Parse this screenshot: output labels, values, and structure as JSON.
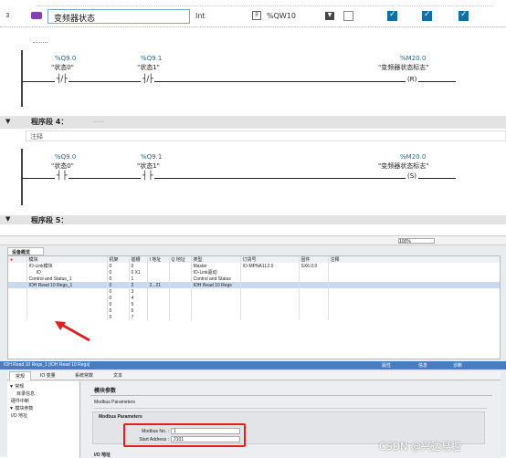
{
  "tag_row": {
    "row_number": "3",
    "name": "变频器状态",
    "type": "Int",
    "address": "%QW10"
  },
  "network3": {
    "contact1": {
      "address": "%Q9.0",
      "label": "\"状态0\""
    },
    "contact2": {
      "address": "%Q9.1",
      "label": "\"状态1\""
    },
    "coil": {
      "address": "%M20.0",
      "label": "\"变频器状态标志\"",
      "symbol": "R"
    }
  },
  "network4": {
    "header": "程序段 4：",
    "header_dots": "......",
    "comment": "注释",
    "contact1": {
      "address": "%Q9.0",
      "label": "\"状态0\""
    },
    "contact2": {
      "address": "%Q9.1",
      "label": "\"状态1\""
    },
    "coil": {
      "address": "%M20.0",
      "label": "\"变频器状态标志\"",
      "symbol": "S"
    }
  },
  "network5": {
    "header": "程序段 5："
  },
  "device_overview": {
    "zoom": "100%",
    "tab": "设备概览",
    "columns": [
      "模块",
      "机架",
      "插槽",
      "I 地址",
      "Q 地址",
      "类型",
      "订货号",
      "固件",
      "注释"
    ],
    "rows": [
      {
        "module": "IO-Link模块",
        "rack": "0",
        "slot": "0",
        "i_addr": "",
        "q_addr": "",
        "type": "Master",
        "order": "IO-MPNA1L2.0",
        "fw": "SX6.0.0"
      },
      {
        "module": "IO",
        "rack": "0",
        "slot": "0 X1",
        "i_addr": "",
        "q_addr": "",
        "type": "IO-Link驱动",
        "order": "",
        "fw": ""
      },
      {
        "module": "Control and Status_1",
        "rack": "0",
        "slot": "1",
        "i_addr": "",
        "q_addr": "",
        "type": "Control and Status",
        "order": "",
        "fw": ""
      },
      {
        "module": "IOH Read 10 Regs_1",
        "rack": "0",
        "slot": "2",
        "i_addr": "2...21",
        "q_addr": "",
        "type": "IOH Read 10 Regs",
        "order": "",
        "fw": ""
      },
      {
        "module": "",
        "rack": "0",
        "slot": "3",
        "i_addr": "",
        "q_addr": "",
        "type": "",
        "order": "",
        "fw": ""
      },
      {
        "module": "",
        "rack": "0",
        "slot": "4",
        "i_addr": "",
        "q_addr": "",
        "type": "",
        "order": "",
        "fw": ""
      },
      {
        "module": "",
        "rack": "0",
        "slot": "5",
        "i_addr": "",
        "q_addr": "",
        "type": "",
        "order": "",
        "fw": ""
      },
      {
        "module": "",
        "rack": "0",
        "slot": "6",
        "i_addr": "",
        "q_addr": "",
        "type": "",
        "order": "",
        "fw": ""
      },
      {
        "module": "",
        "rack": "0",
        "slot": "7",
        "i_addr": "",
        "q_addr": "",
        "type": "",
        "order": "",
        "fw": ""
      }
    ]
  },
  "properties": {
    "title": "IOH Read 10 Regs_1 [IOH Read 10 Regs]",
    "right_tabs": [
      "属性",
      "信息",
      "诊断"
    ],
    "tabs": [
      "常规",
      "IO 变量",
      "系统常数",
      "文本"
    ],
    "tree": [
      "▼ 常规",
      "目录信息",
      "硬件中断",
      "▼ 模块参数",
      "I/O 地址"
    ],
    "section_title": "模块参数",
    "group_title": "Modbus Parameters",
    "sub_title": "Modbus Parameters",
    "field1_label": "Modbus No. :",
    "field1_value": "1",
    "field2_label": "Start Address :",
    "field2_value": "2101",
    "bottom_section": "I/O 地址",
    "watermark": "CSDN @兴达易控"
  }
}
